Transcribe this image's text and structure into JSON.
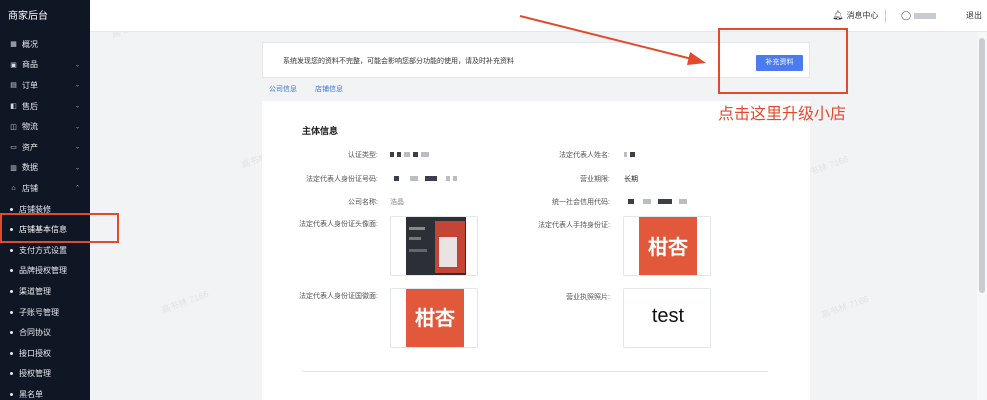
{
  "sidebar": {
    "brand": "商家后台",
    "items": [
      {
        "label": "概况",
        "icon": "grid-icon",
        "chevron": false
      },
      {
        "label": "商品",
        "icon": "box-icon",
        "chevron": true
      },
      {
        "label": "订单",
        "icon": "document-icon",
        "chevron": true
      },
      {
        "label": "售后",
        "icon": "return-icon",
        "chevron": true
      },
      {
        "label": "物流",
        "icon": "truck-icon",
        "chevron": true
      },
      {
        "label": "资产",
        "icon": "wallet-icon",
        "chevron": true
      },
      {
        "label": "数据",
        "icon": "chart-icon",
        "chevron": true
      },
      {
        "label": "店铺",
        "icon": "store-icon",
        "chevron": true
      }
    ],
    "subitems": [
      "店铺装修",
      "店铺基本信息",
      "支付方式设置",
      "品牌授权管理",
      "渠道管理",
      "子账号管理",
      "合同协议",
      "接口授权",
      "授权管理",
      "黑名单"
    ]
  },
  "topbar": {
    "messages": "消息中心",
    "logout": "退出"
  },
  "notice": {
    "text": "系统发现您的资料不完整，可能会影响您部分功能的使用，请及时补充资料",
    "button": "补充资料"
  },
  "tabs": [
    "公司信息",
    "店铺信息"
  ],
  "section": {
    "title": "主体信息",
    "fields": {
      "cert_type": "认证类型:",
      "legal_name": "法定代表人姓名:",
      "legal_id": "法定代表人身份证号码:",
      "business_term": "营业期限:",
      "business_term_value": "长期",
      "company_name": "公司名称:",
      "company_name_value": "浩晶",
      "credit_code": "统一社会信用代码:",
      "id_front": "法定代表人身份证头像面:",
      "id_handheld": "法定代表人手持身份证:",
      "id_back": "法定代表人身份证国徽面:",
      "license": "营业执照照片:"
    },
    "images": {
      "handheld_text": "柑杏",
      "back_text": "柑杏",
      "license_text": "test"
    }
  },
  "annotation": {
    "text": "点击这里升级小店",
    "color": "#e34a2b"
  },
  "watermark": "高书林 7166",
  "colors": {
    "primary": "#4a7cf0",
    "sidebar_bg": "#0f1624",
    "annotation": "#e34a2b"
  }
}
